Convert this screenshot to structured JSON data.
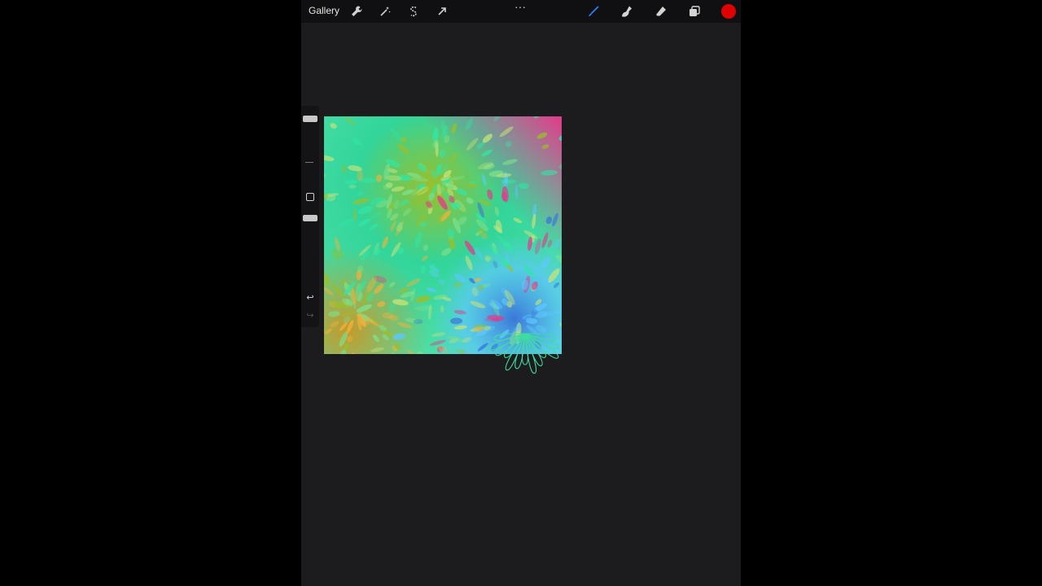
{
  "toolbar": {
    "gallery_label": "Gallery",
    "left_tools": [
      {
        "name": "actions-wrench-icon"
      },
      {
        "name": "adjustments-wand-icon"
      },
      {
        "name": "selection-s-icon"
      },
      {
        "name": "transform-arrow-icon"
      }
    ],
    "more_label": "···",
    "right_tools": [
      {
        "name": "brush-icon",
        "active": true
      },
      {
        "name": "smudge-icon"
      },
      {
        "name": "eraser-icon"
      },
      {
        "name": "layers-icon"
      }
    ],
    "current_color": "#e00000",
    "active_tool_color": "#2f7cf6"
  },
  "sidebar": {
    "brush_size_label": "",
    "opacity_label": "",
    "undo_icon": "undo-arrow-icon",
    "redo_icon": "redo-arrow-icon"
  },
  "canvas": {
    "palette": [
      "#32e6a5",
      "#9bbf2a",
      "#5ec7ff",
      "#3a78d8",
      "#e23a8a",
      "#f1b23c",
      "#7de08c",
      "#c3e37a"
    ],
    "stroke_outline_color": "#3fdca0"
  }
}
